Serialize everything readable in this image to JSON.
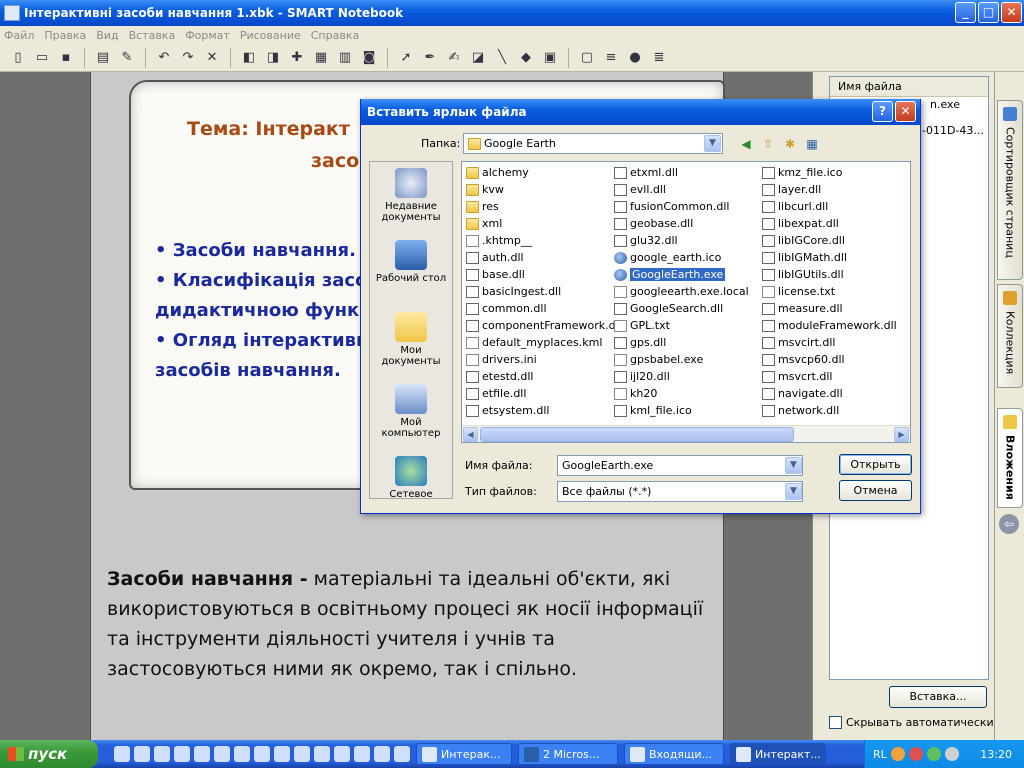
{
  "window": {
    "title": "Інтерактивні засоби навчання 1.xbk - SMART Notebook",
    "min": "_",
    "max": "□",
    "close": "✕"
  },
  "menu": [
    "Файл",
    "Правка",
    "Вид",
    "Вставка",
    "Формат",
    "Рисование",
    "Справка"
  ],
  "slide": {
    "title_line1": "Тема: Інтеракт",
    "title_line2": "засо",
    "bullets": [
      "• Засоби навчання.",
      "• Класифікація засо",
      "дидактичною функ",
      "• Огляд інтерактивн",
      "засобів навчання."
    ],
    "term": "Засоби навчання -",
    "definition": " матеріальні та ідеальні об'єкти, які використовуються в освітньому процесі як носії інформації та інструменти діяльності учителя і учнів та застосовуються ними як окремо, так і спільно."
  },
  "sidepanel": {
    "header": "Имя файла",
    "rows": [
      "n.exe",
      "-011D-43..."
    ],
    "insert_button": "Вставка...",
    "autohide": "Скрывать автоматически"
  },
  "vtabs": [
    "Сортировщик страниц",
    "Коллекция",
    "Вложения"
  ],
  "dialog": {
    "title": "Вставить ярлык файла",
    "help": "?",
    "close": "✕",
    "folder_label": "Папка:",
    "folder_value": "Google Earth",
    "places": [
      "Недавние документы",
      "Рабочий стол",
      "Мои документы",
      "Мой компьютер",
      "Сетевое"
    ],
    "columns": [
      [
        {
          "name": "alchemy",
          "type": "folder"
        },
        {
          "name": "kvw",
          "type": "folder"
        },
        {
          "name": "res",
          "type": "folder"
        },
        {
          "name": "xml",
          "type": "folder"
        },
        {
          "name": ".khtmp__",
          "type": "file"
        },
        {
          "name": "auth.dll",
          "type": "dll"
        },
        {
          "name": "base.dll",
          "type": "dll"
        },
        {
          "name": "basicIngest.dll",
          "type": "dll"
        },
        {
          "name": "common.dll",
          "type": "dll"
        },
        {
          "name": "componentFramework.dll",
          "type": "dll"
        },
        {
          "name": "default_myplaces.kml",
          "type": "file"
        },
        {
          "name": "drivers.ini",
          "type": "file"
        },
        {
          "name": "etestd.dll",
          "type": "dll"
        },
        {
          "name": "etfile.dll",
          "type": "dll"
        },
        {
          "name": "etsystem.dll",
          "type": "dll"
        }
      ],
      [
        {
          "name": "etxml.dll",
          "type": "dll"
        },
        {
          "name": "evll.dll",
          "type": "dll"
        },
        {
          "name": "fusionCommon.dll",
          "type": "dll"
        },
        {
          "name": "geobase.dll",
          "type": "dll"
        },
        {
          "name": "glu32.dll",
          "type": "dll"
        },
        {
          "name": "google_earth.ico",
          "type": "globe"
        },
        {
          "name": "GoogleEarth.exe",
          "type": "globe",
          "selected": true
        },
        {
          "name": "googleearth.exe.local",
          "type": "file"
        },
        {
          "name": "GoogleSearch.dll",
          "type": "dll"
        },
        {
          "name": "GPL.txt",
          "type": "file"
        },
        {
          "name": "gps.dll",
          "type": "dll"
        },
        {
          "name": "gpsbabel.exe",
          "type": "file"
        },
        {
          "name": "ijl20.dll",
          "type": "dll"
        },
        {
          "name": "kh20",
          "type": "file"
        },
        {
          "name": "kml_file.ico",
          "type": "dll"
        }
      ],
      [
        {
          "name": "kmz_file.ico",
          "type": "dll"
        },
        {
          "name": "layer.dll",
          "type": "dll"
        },
        {
          "name": "libcurl.dll",
          "type": "dll"
        },
        {
          "name": "libexpat.dll",
          "type": "dll"
        },
        {
          "name": "libIGCore.dll",
          "type": "dll"
        },
        {
          "name": "libIGMath.dll",
          "type": "dll"
        },
        {
          "name": "libIGUtils.dll",
          "type": "dll"
        },
        {
          "name": "license.txt",
          "type": "file"
        },
        {
          "name": "measure.dll",
          "type": "dll"
        },
        {
          "name": "moduleFramework.dll",
          "type": "dll"
        },
        {
          "name": "msvcirt.dll",
          "type": "dll"
        },
        {
          "name": "msvcp60.dll",
          "type": "dll"
        },
        {
          "name": "msvcrt.dll",
          "type": "dll"
        },
        {
          "name": "navigate.dll",
          "type": "dll"
        },
        {
          "name": "network.dll",
          "type": "dll"
        }
      ]
    ],
    "filename_label": "Имя файла:",
    "filename_value": "GoogleEarth.exe",
    "filetype_label": "Тип файлов:",
    "filetype_value": "Все файлы (*.*)",
    "open_button": "Открыть",
    "cancel_button": "Отмена"
  },
  "taskbar": {
    "start": "пуск",
    "tasks": [
      {
        "label": "Интерак..."
      },
      {
        "label": "2 Micros..."
      },
      {
        "label": "Входящи..."
      },
      {
        "label": "Интеракт..."
      }
    ],
    "lang": "RL",
    "clock": "13:20"
  }
}
